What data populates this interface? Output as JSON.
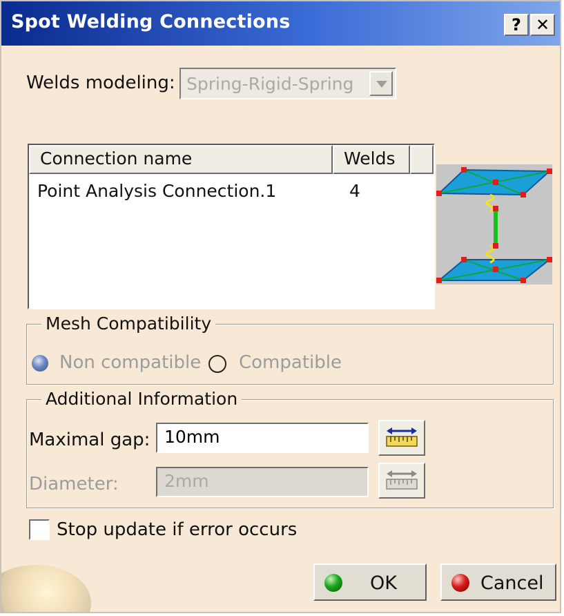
{
  "dialog": {
    "title": "Spot Welding Connections",
    "help_button": "?",
    "close_button": "✕"
  },
  "welds_modeling": {
    "label": "Welds modeling:",
    "value": "Spring-Rigid-Spring"
  },
  "connections_table": {
    "columns": [
      "Connection name",
      "Welds"
    ],
    "rows": [
      {
        "name": "Point Analysis Connection.1",
        "welds": "4"
      }
    ]
  },
  "mesh_compatibility": {
    "legend": "Mesh Compatibility",
    "options": [
      {
        "label": "Non compatible",
        "selected": true
      },
      {
        "label": "Compatible",
        "selected": false
      }
    ]
  },
  "additional_information": {
    "legend": "Additional Information",
    "maximal_gap": {
      "label": "Maximal gap:",
      "value": "10mm"
    },
    "diameter": {
      "label": "Diameter:",
      "value": "2mm"
    }
  },
  "stop_update": {
    "label": "Stop update if error occurs",
    "checked": false
  },
  "buttons": {
    "ok": "OK",
    "cancel": "Cancel"
  },
  "icons": {
    "measure": "measure-icon",
    "weld_preview": "spring-rigid-spring-preview"
  },
  "colors": {
    "title_bar": "#0a2a8e",
    "dialog_bg": "#f7e9d6",
    "ok_ball": "#1aa51a",
    "cancel_ball": "#d81b1b"
  }
}
